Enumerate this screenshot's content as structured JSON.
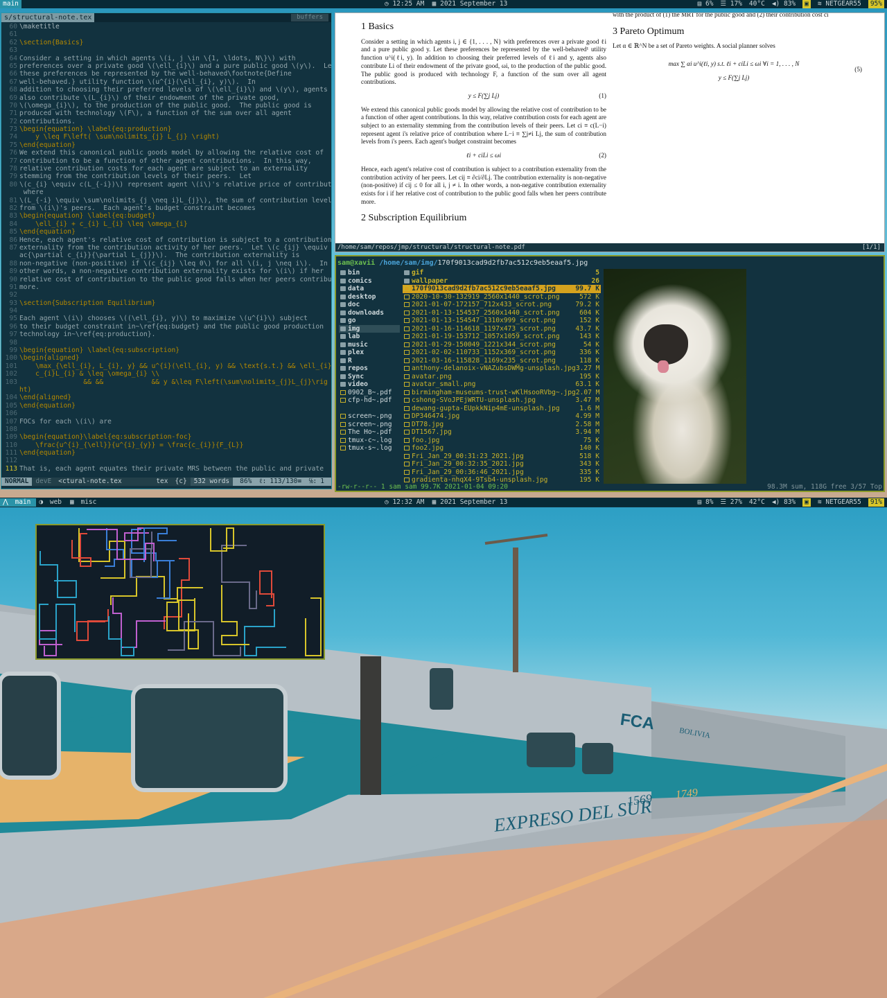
{
  "top_bar": {
    "workspace": "main",
    "clock": "12:25 AM",
    "date": "2021 September 13",
    "stats": [
      "6%",
      "17%",
      "40°C",
      "83%",
      "NETGEAR55",
      "95%"
    ]
  },
  "bottom_bar": {
    "workspaces": [
      "main",
      "web",
      "misc"
    ],
    "clock": "12:32 AM",
    "date": "2021 September 13",
    "stats": [
      "8%",
      "27%",
      "42°C",
      "83%",
      "NETGEAR55",
      "91%"
    ]
  },
  "vim": {
    "tab": "s/structural-note.tex",
    "buffers_label": "buffers",
    "lines": [
      {
        "n": "60",
        "t": "\\maketitle",
        "c": "cmt"
      },
      {
        "n": "61",
        "t": "",
        "c": ""
      },
      {
        "n": "62",
        "t": "\\section{Basics}",
        "c": "head"
      },
      {
        "n": "63",
        "t": "",
        "c": ""
      },
      {
        "n": "64",
        "t": "Consider a setting in which agents \\(i, j \\in \\{1, \\ldots, N\\}\\) with",
        "c": ""
      },
      {
        "n": "65",
        "t": "preferences over a private good \\(\\ell_{i}\\) and a pure public good \\(y\\).  Let",
        "c": ""
      },
      {
        "n": "66",
        "t": "these preferences be represented by the well-behaved\\footnote{Define",
        "c": ""
      },
      {
        "n": "67",
        "t": "well-behaved.} utility function \\(u^{i}(\\ell_{i}, y)\\).  In",
        "c": ""
      },
      {
        "n": "68",
        "t": "addition to choosing their preferred levels of \\(\\ell_{i}\\) and \\(y\\), agents",
        "c": ""
      },
      {
        "n": "69",
        "t": "also contribute \\(L_{i}\\) of their endowment of the private good,",
        "c": ""
      },
      {
        "n": "70",
        "t": "\\(\\omega_{i}\\), to the production of the public good.  The public good is",
        "c": ""
      },
      {
        "n": "71",
        "t": "produced with technology \\(F\\), a function of the sum over all agent",
        "c": ""
      },
      {
        "n": "72",
        "t": "contributions.",
        "c": ""
      },
      {
        "n": "73",
        "t": "\\begin{equation} \\label{eq:production}",
        "c": "head"
      },
      {
        "n": "74",
        "t": "    y \\leq F\\left( \\sum\\nolimits_{j} L_{j} \\right)",
        "c": "head"
      },
      {
        "n": "75",
        "t": "\\end{equation}",
        "c": "head"
      },
      {
        "n": "76",
        "t": "We extend this canonical public goods model by allowing the relative cost of",
        "c": ""
      },
      {
        "n": "77",
        "t": "contribution to be a function of other agent contributions.  In this way,",
        "c": ""
      },
      {
        "n": "78",
        "t": "relative contribution costs for each agent are subject to an externality",
        "c": ""
      },
      {
        "n": "79",
        "t": "stemming from the contribution levels of their peers.  Let",
        "c": ""
      },
      {
        "n": "80",
        "t": "\\(c_{i} \\equiv c(L_{-i})\\) represent agent \\(i\\)'s relative price of contribution",
        "c": ""
      },
      {
        "n": "",
        "t": " where",
        "c": ""
      },
      {
        "n": "81",
        "t": "\\(L_{-i} \\equiv \\sum\\nolimits_{j \\neq i}L_{j}\\), the sum of contribution levels",
        "c": ""
      },
      {
        "n": "82",
        "t": "from \\(i\\)'s peers.  Each agent's budget constraint becomes",
        "c": ""
      },
      {
        "n": "83",
        "t": "\\begin{equation} \\label{eq:budget}",
        "c": "head"
      },
      {
        "n": "84",
        "t": "    \\ell_{i} + c_{i} L_{i} \\leq \\omega_{i}",
        "c": "head"
      },
      {
        "n": "85",
        "t": "\\end{equation}",
        "c": "head"
      },
      {
        "n": "86",
        "t": "Hence, each agent's relative cost of contribution is subject to a contribution",
        "c": ""
      },
      {
        "n": "87",
        "t": "externality from the contribution activity of her peers.  Let \\(c_{ij} \\equiv \\fr",
        "c": ""
      },
      {
        "n": "",
        "t": "ac{\\partial c_{i}}{\\partial L_{j}}\\).  The contribution externality is",
        "c": ""
      },
      {
        "n": "88",
        "t": "non-negative (non-positive) if \\(c_{ij} \\leq 0\\) for all \\(i, j \\neq i\\).  In",
        "c": ""
      },
      {
        "n": "89",
        "t": "other words, a non-negative contribution externality exists for \\(i\\) if her",
        "c": ""
      },
      {
        "n": "90",
        "t": "relative cost of contribution to the public good falls when her peers contribute",
        "c": ""
      },
      {
        "n": "91",
        "t": "more.",
        "c": ""
      },
      {
        "n": "92",
        "t": "",
        "c": ""
      },
      {
        "n": "93",
        "t": "\\section{Subscription Equilibrium}",
        "c": "head"
      },
      {
        "n": "94",
        "t": "",
        "c": ""
      },
      {
        "n": "95",
        "t": "Each agent \\(i\\) chooses \\((\\ell_{i}, y)\\) to maximize \\(u^{i}\\) subject",
        "c": ""
      },
      {
        "n": "96",
        "t": "to their budget constraint in~\\ref{eq:budget} and the public good production",
        "c": ""
      },
      {
        "n": "97",
        "t": "technology in~\\ref{eq:production}.",
        "c": ""
      },
      {
        "n": "98",
        "t": "",
        "c": ""
      },
      {
        "n": "99",
        "t": "\\begin{equation} \\label{eq:subscription}",
        "c": "head"
      },
      {
        "n": "100",
        "t": "\\begin{aligned}",
        "c": "head"
      },
      {
        "n": "101",
        "t": "    \\max_{\\ell_{i}, L_{i}, y} && u^{i}(\\ell_{i}, y) && \\text{s.t.} && \\ell_{i} +",
        "c": "head"
      },
      {
        "n": "102",
        "t": "    c_{i}L_{i} & \\leq \\omega_{i} \\\\",
        "c": "head"
      },
      {
        "n": "103",
        "t": "                && &&            && y &\\leq F\\left(\\sum\\nolimits_{j}L_{j}\\rig",
        "c": "head"
      },
      {
        "n": "",
        "t": "ht)",
        "c": "head"
      },
      {
        "n": "104",
        "t": "\\end{aligned}",
        "c": "head"
      },
      {
        "n": "105",
        "t": "\\end{equation}",
        "c": "head"
      },
      {
        "n": "106",
        "t": "",
        "c": ""
      },
      {
        "n": "107",
        "t": "FOCs for each \\(i\\) are",
        "c": ""
      },
      {
        "n": "108",
        "t": "",
        "c": ""
      },
      {
        "n": "109",
        "t": "\\begin{equation}\\label{eq:subscription-foc}",
        "c": "head"
      },
      {
        "n": "110",
        "t": "    \\frac{u^{i}_{\\ell}}{u^{i}_{y}} = \\frac{c_{i}}{F_{L}}",
        "c": "head"
      },
      {
        "n": "111",
        "t": "\\end{equation}",
        "c": "head"
      },
      {
        "n": "112",
        "t": "",
        "c": ""
      },
      {
        "n": "113",
        "t": "That is, each agent equates their private MRS between the public and private",
        "c": "cur"
      }
    ],
    "status": {
      "mode": "NORMAL",
      "branch": "devE",
      "file": "<ctural-note.tex",
      "ft": "tex",
      "scope": "{c}",
      "words": "532 words",
      "pos": "86%",
      "line": "113/130≡",
      "col": "1"
    }
  },
  "pdf": {
    "left_col": {
      "section": "1   Basics",
      "p1": "Consider a setting in which agents i, j ∈ {1, . . . , N} with preferences over a private good ℓi and a pure public good y. Let these preferences be represented by the well-behaved¹ utility function u^i(ℓi, y). In addition to choosing their preferred levels of ℓi and y, agents also contribute Li of their endowment of the private good, ωi, to the production of the public good. The public good is produced with technology F, a function of the sum over all agent contributions.",
      "eq1": "y ≤ F(∑j Lj)",
      "eq1n": "(1)",
      "p2": "We extend this canonical public goods model by allowing the relative cost of contribution to be a function of other agent contributions. In this way, relative contribution costs for each agent are subject to an externality stemming from the contribution levels of their peers. Let ci ≡ c(L−i) represent agent i's relative price of contribution where L−i ≡ ∑j≠i Lj, the sum of contribution levels from i's peers. Each agent's budget constraint becomes",
      "eq2": "ℓi + ciLi ≤ ωi",
      "eq2n": "(2)",
      "p3": "Hence, each agent's relative cost of contribution is subject to a contribution externality from the contribution activity of her peers. Let cij ≡ ∂ci/∂Lj. The contribution externality is non-negative (non-positive) if cij ≤ 0 for all i, j ≠ i. In other words, a non-negative contribution externality exists for i if her relative cost of contribution to the public good falls when her peers contribute more.",
      "next": "2   Subscription Equilibrium"
    },
    "right_col": {
      "top": "with the product of (1) the MRT for the public good and (2) their contribution cost ci",
      "section": "3   Pareto Optimum",
      "p1": "Let α ∈ ℝ^N be a set of Pareto weights. A social planner solves",
      "eq5a": "max  ∑ αi u^i(ℓi, y)   s.t.   ℓi + ciLi ≤ ωi   ∀i = 1, . . . , N",
      "eq5b": "y ≤ F(∑j Lj)",
      "eq5n": "(5)"
    },
    "path": "/home/sam/repos/jmp/structural/structural-note.pdf",
    "page": "[1/1]"
  },
  "fm": {
    "user": "sam@xavii",
    "dir": "/home/sam/img/",
    "file": "170f9013cad9d2fb7ac512c9eb5eaaf5.jpg",
    "dirs": [
      {
        "name": "bin",
        "k": "d"
      },
      {
        "name": "comics",
        "k": "d"
      },
      {
        "name": "data",
        "k": "d"
      },
      {
        "name": "desktop",
        "k": "d"
      },
      {
        "name": "doc",
        "k": "d"
      },
      {
        "name": "downloads",
        "k": "d"
      },
      {
        "name": "go",
        "k": "d"
      },
      {
        "name": "img",
        "k": "sel"
      },
      {
        "name": "lab",
        "k": "d"
      },
      {
        "name": "music",
        "k": "d"
      },
      {
        "name": "plex",
        "k": "d"
      },
      {
        "name": "R",
        "k": "d"
      },
      {
        "name": "repos",
        "k": "d"
      },
      {
        "name": "Sync",
        "k": "d"
      },
      {
        "name": "video",
        "k": "d"
      },
      {
        "name": "0902_B~.pdf",
        "k": "f"
      },
      {
        "name": "cfp-hd~.pdf",
        "k": "f"
      },
      {
        "name": "",
        "k": "f"
      },
      {
        "name": "screen~.png",
        "k": "f"
      },
      {
        "name": "screen~.png",
        "k": "f"
      },
      {
        "name": "The Ho~.pdf",
        "k": "f"
      },
      {
        "name": "tmux-c~.log",
        "k": "f"
      },
      {
        "name": "tmux-s~.log",
        "k": "f"
      }
    ],
    "files": [
      {
        "name": "gif",
        "size": "5",
        "k": "dir"
      },
      {
        "name": "wallpaper",
        "size": "26",
        "k": "dir"
      },
      {
        "name": "170f9013cad9d2fb7ac512c9eb5eaaf5.jpg",
        "size": "99.7 K",
        "k": "sel"
      },
      {
        "name": "2020-10-30-132919_2560x1440_scrot.png",
        "size": "572 K",
        "k": ""
      },
      {
        "name": "2021-01-07-172157_712x433_scrot.png",
        "size": "79.2 K",
        "k": ""
      },
      {
        "name": "2021-01-13-154537_2560x1440_scrot.png",
        "size": "604 K",
        "k": ""
      },
      {
        "name": "2021-01-13-154547_1310x999_scrot.png",
        "size": "152 K",
        "k": ""
      },
      {
        "name": "2021-01-16-114618_1197x473_scrot.png",
        "size": "43.7 K",
        "k": ""
      },
      {
        "name": "2021-01-19-153712_1057x1059_scrot.png",
        "size": "143 K",
        "k": ""
      },
      {
        "name": "2021-01-29-150049_1221x344_scrot.png",
        "size": "54 K",
        "k": ""
      },
      {
        "name": "2021-02-02-110733_1152x369_scrot.png",
        "size": "336 K",
        "k": ""
      },
      {
        "name": "2021-03-16-115828_1169x235_scrot.png",
        "size": "118 K",
        "k": ""
      },
      {
        "name": "anthony-delanoix-vNAZubsDWMg-unsplash.jpg",
        "size": "3.27 M",
        "k": ""
      },
      {
        "name": "avatar.png",
        "size": "195 K",
        "k": ""
      },
      {
        "name": "avatar_small.png",
        "size": "63.1 K",
        "k": ""
      },
      {
        "name": "birmingham-museums-trust-wKlHsooRVbg~.jpg",
        "size": "2.07 M",
        "k": ""
      },
      {
        "name": "cshong-SVoJPEjWRTU-unsplash.jpg",
        "size": "3.47 M",
        "k": ""
      },
      {
        "name": "dewang-gupta-EUpkkNip4mE-unsplash.jpg",
        "size": "1.6 M",
        "k": ""
      },
      {
        "name": "DP346474.jpg",
        "size": "4.99 M",
        "k": ""
      },
      {
        "name": "DT78.jpg",
        "size": "2.58 M",
        "k": ""
      },
      {
        "name": "DT1567.jpg",
        "size": "3.94 M",
        "k": ""
      },
      {
        "name": "foo.jpg",
        "size": "75 K",
        "k": ""
      },
      {
        "name": "foo2.jpg",
        "size": "140 K",
        "k": ""
      },
      {
        "name": "Fri_Jan_29_00:31:23_2021.jpg",
        "size": "518 K",
        "k": ""
      },
      {
        "name": "Fri_Jan_29_00:32:35_2021.jpg",
        "size": "343 K",
        "k": ""
      },
      {
        "name": "Fri_Jan_29_00:36:46_2021.jpg",
        "size": "335 K",
        "k": ""
      },
      {
        "name": "gradienta-nhqX4-9Tsb4-unsplash.jpg",
        "size": "195 K",
        "k": ""
      }
    ],
    "status_left": "-rw-r--r-- 1 sam sam 99.7K 2021-01-04 09:20",
    "status_right": "98.3M sum, 118G free  3/57  Top"
  },
  "wallpaper": {
    "train_text": "EXPRESO DEL SUR",
    "car_no_1": "1569",
    "car_no_2": "1749",
    "logo": "FCA",
    "sub": "BOLIVIA"
  }
}
